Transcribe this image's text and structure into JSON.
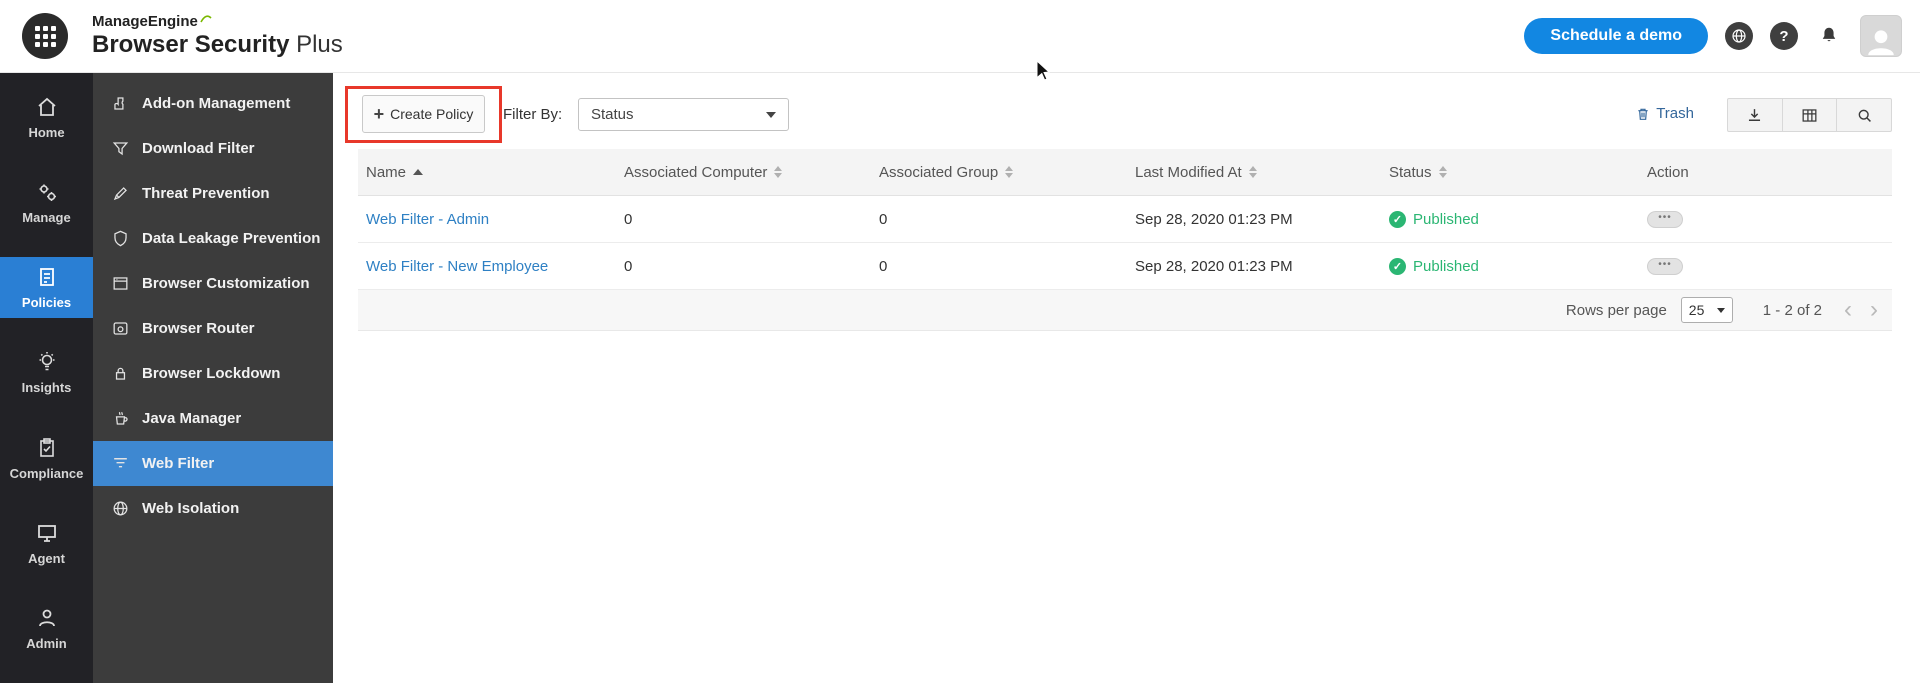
{
  "header": {
    "brand_top": "ManageEngine",
    "product_bold": "Browser Security",
    "product_light": "Plus",
    "schedule_demo": "Schedule a demo"
  },
  "sidebar_primary": {
    "items": [
      {
        "label": "Home",
        "icon": "home-icon"
      },
      {
        "label": "Manage",
        "icon": "gears-icon"
      },
      {
        "label": "Policies",
        "icon": "policies-icon",
        "active": true
      },
      {
        "label": "Insights",
        "icon": "insights-icon"
      },
      {
        "label": "Compliance",
        "icon": "compliance-icon"
      },
      {
        "label": "Agent",
        "icon": "agent-icon"
      },
      {
        "label": "Admin",
        "icon": "admin-icon"
      }
    ]
  },
  "sidebar_secondary": {
    "items": [
      {
        "label": "Add-on Management",
        "icon": "puzzle-icon"
      },
      {
        "label": "Download Filter",
        "icon": "funnel-icon"
      },
      {
        "label": "Threat Prevention",
        "icon": "pen-icon"
      },
      {
        "label": "Data Leakage Prevention",
        "icon": "shield-icon"
      },
      {
        "label": "Browser Customization",
        "icon": "window-icon"
      },
      {
        "label": "Browser Router",
        "icon": "router-icon"
      },
      {
        "label": "Browser Lockdown",
        "icon": "lock-icon"
      },
      {
        "label": "Java Manager",
        "icon": "java-cup-icon"
      },
      {
        "label": "Web Filter",
        "icon": "filter-lines-icon",
        "active": true
      },
      {
        "label": "Web Isolation",
        "icon": "globe-icon"
      }
    ]
  },
  "toolbar": {
    "create_policy": "Create Policy",
    "filter_by": "Filter By:",
    "filter_value": "Status",
    "trash": "Trash"
  },
  "table": {
    "columns": [
      "Name",
      "Associated Computer",
      "Associated Group",
      "Last Modified At",
      "Status",
      "Action"
    ],
    "rows": [
      {
        "name": "Web Filter - Admin",
        "computers": "0",
        "groups": "0",
        "modified": "Sep 28, 2020 01:23 PM",
        "status": "Published"
      },
      {
        "name": "Web Filter - New Employee",
        "computers": "0",
        "groups": "0",
        "modified": "Sep 28, 2020 01:23 PM",
        "status": "Published"
      }
    ],
    "footer": {
      "rows_per_page_label": "Rows per page",
      "rows_per_page_value": "25",
      "range": "1 - 2 of 2"
    }
  },
  "icons": {
    "question": "?",
    "plus": "+",
    "check": "✓",
    "ellipsis": "•••",
    "prev": "‹",
    "next": "›"
  },
  "colors": {
    "accent_blue": "#1287e2",
    "active_blue": "#2a7fd4",
    "link_blue": "#2e80c4",
    "published_green": "#2bb673",
    "annotation_red": "#e8382a"
  }
}
